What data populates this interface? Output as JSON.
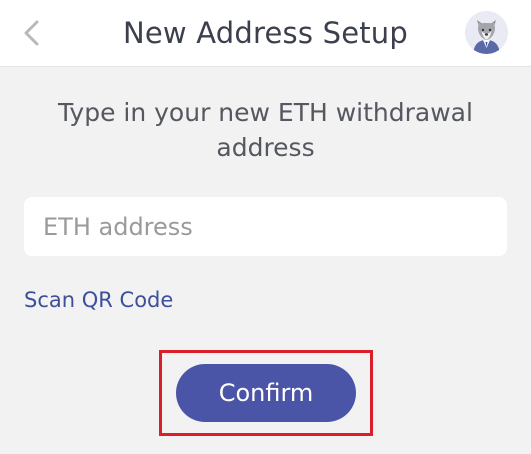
{
  "header": {
    "title": "New Address Setup",
    "back_icon": "chevron-left-icon",
    "avatar_icon": "wolf-avatar-icon"
  },
  "main": {
    "instruction": "Type in your new ETH withdrawal address",
    "address_input": {
      "placeholder": "ETH address",
      "value": ""
    },
    "scan_link": "Scan QR Code",
    "confirm_label": "Confirm"
  },
  "colors": {
    "background": "#f2f2f2",
    "primary_button": "#4a55a8",
    "link": "#3d4f9a",
    "highlight": "#d81f2a"
  }
}
